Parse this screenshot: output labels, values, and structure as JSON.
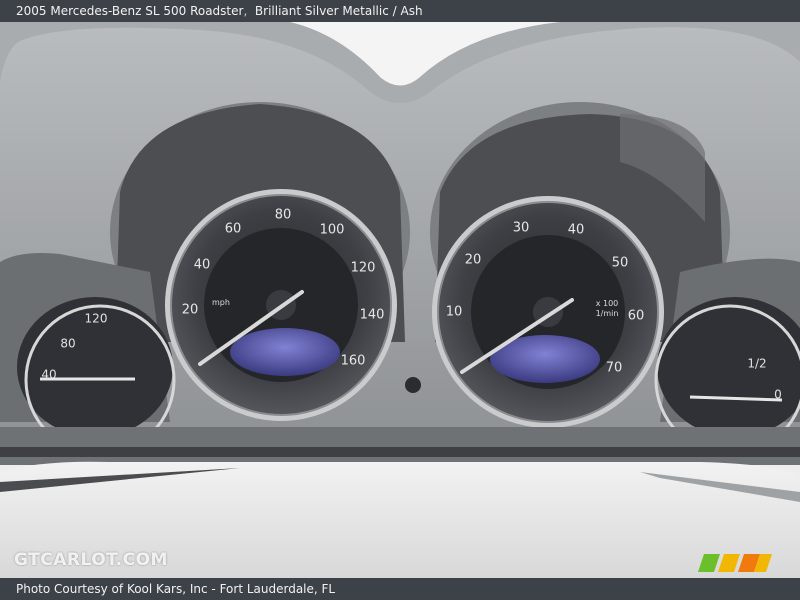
{
  "header": {
    "title": "2005 Mercedes-Benz SL 500 Roadster",
    "separator": ",",
    "color": "Brilliant Silver Metallic / Ash"
  },
  "footer": {
    "credit": "Photo Courtesy of Kool Kars, Inc - Fort Lauderdale, FL"
  },
  "watermark": {
    "text": "GTCARLOT.COM"
  },
  "photo": {
    "speedometer": {
      "numbers": [
        "20",
        "40",
        "60",
        "80",
        "100",
        "120",
        "140",
        "160"
      ],
      "unit": "mph"
    },
    "tachometer": {
      "numbers": [
        "10",
        "20",
        "30",
        "40",
        "50",
        "60",
        "70"
      ],
      "unit_line1": "x 100",
      "unit_line2": "1/min"
    },
    "left_gauge": {
      "numbers": [
        "40",
        "80",
        "120"
      ]
    },
    "right_gauge": {
      "numbers": [
        "1/2",
        "0"
      ]
    }
  },
  "colors": {
    "bar_background": "#3d4148",
    "logo_green": "#6abf2b",
    "logo_yellow": "#f2b705",
    "logo_orange": "#f07b0c"
  }
}
